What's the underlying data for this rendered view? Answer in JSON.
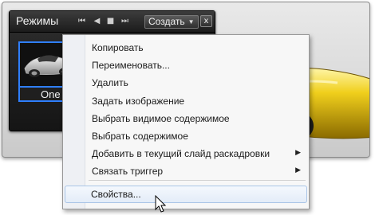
{
  "palette": {
    "title": "Режимы",
    "create_label": "Создать",
    "close_label": "x",
    "mode_name": "One"
  },
  "context_menu": {
    "items": [
      {
        "label": "Копировать",
        "submenu": false
      },
      {
        "label": "Переименовать...",
        "submenu": false
      },
      {
        "label": "Удалить",
        "submenu": false
      },
      {
        "label": "Задать изображение",
        "submenu": false
      },
      {
        "label": "Выбрать видимое содержимое",
        "submenu": false
      },
      {
        "label": "Выбрать содержимое",
        "submenu": false
      },
      {
        "label": "Добавить в текущий слайд раскадровки",
        "submenu": true
      },
      {
        "label": "Связать триггер",
        "submenu": true
      },
      {
        "label": "Свойства...",
        "submenu": false,
        "hovered": true
      }
    ]
  },
  "colors": {
    "selection_border": "#2f7fff",
    "car_yellow": "#e8c21a",
    "menu_hover_border": "#a9c4e6"
  }
}
